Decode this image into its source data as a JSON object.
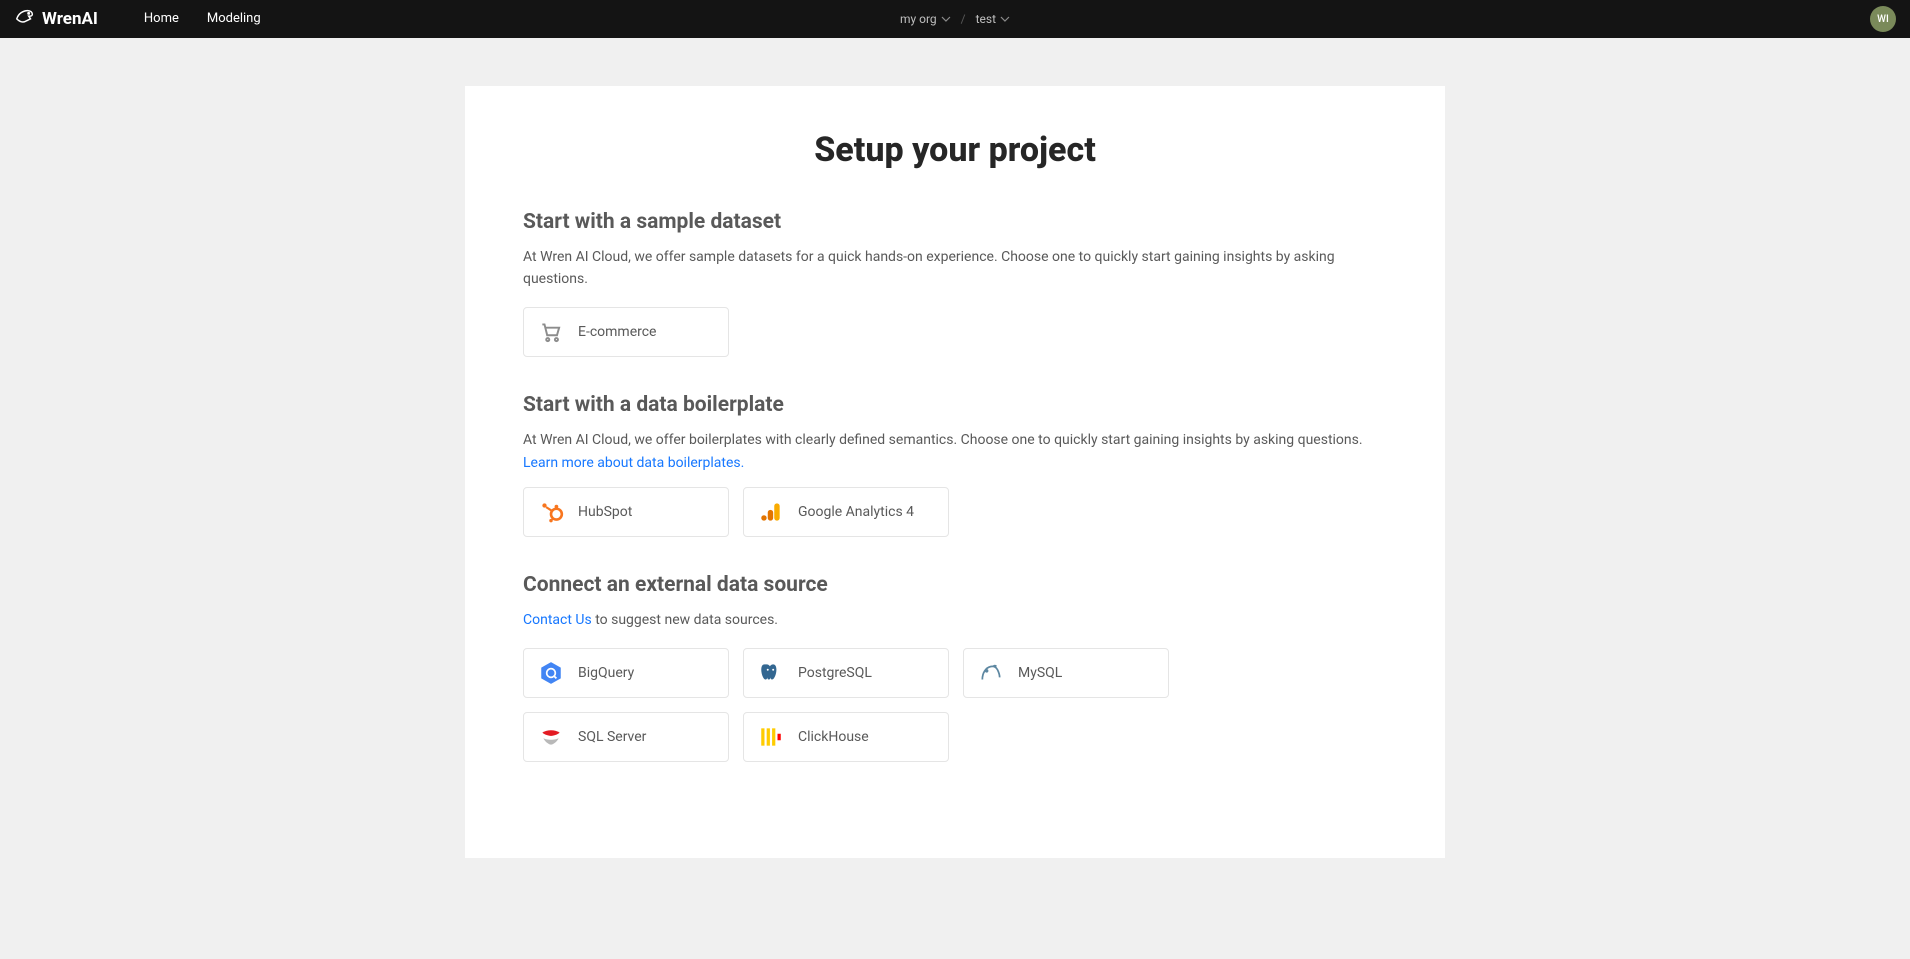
{
  "brand": "WrenAI",
  "nav": {
    "home": "Home",
    "modeling": "Modeling"
  },
  "breadcrumb": {
    "org": "my org",
    "project": "test"
  },
  "avatar_initials": "WI",
  "title": "Setup your project",
  "sections": {
    "sample": {
      "heading": "Start with a sample dataset",
      "desc": "At Wren AI Cloud, we offer sample datasets for a quick hands-on experience. Choose one to quickly start gaining insights by asking questions.",
      "cards": {
        "ecommerce": "E-commerce"
      }
    },
    "boilerplate": {
      "heading": "Start with a data boilerplate",
      "desc": "At Wren AI Cloud, we offer boilerplates with clearly defined semantics. Choose one to quickly start gaining insights by asking questions.",
      "link": "Learn more about data boilerplates.",
      "cards": {
        "hubspot": "HubSpot",
        "ga4": "Google Analytics 4"
      }
    },
    "external": {
      "heading": "Connect an external data source",
      "contact_link": "Contact Us",
      "contact_suffix": " to suggest new data sources.",
      "cards": {
        "bigquery": "BigQuery",
        "postgres": "PostgreSQL",
        "mysql": "MySQL",
        "sqlserver": "SQL Server",
        "clickhouse": "ClickHouse"
      }
    }
  }
}
